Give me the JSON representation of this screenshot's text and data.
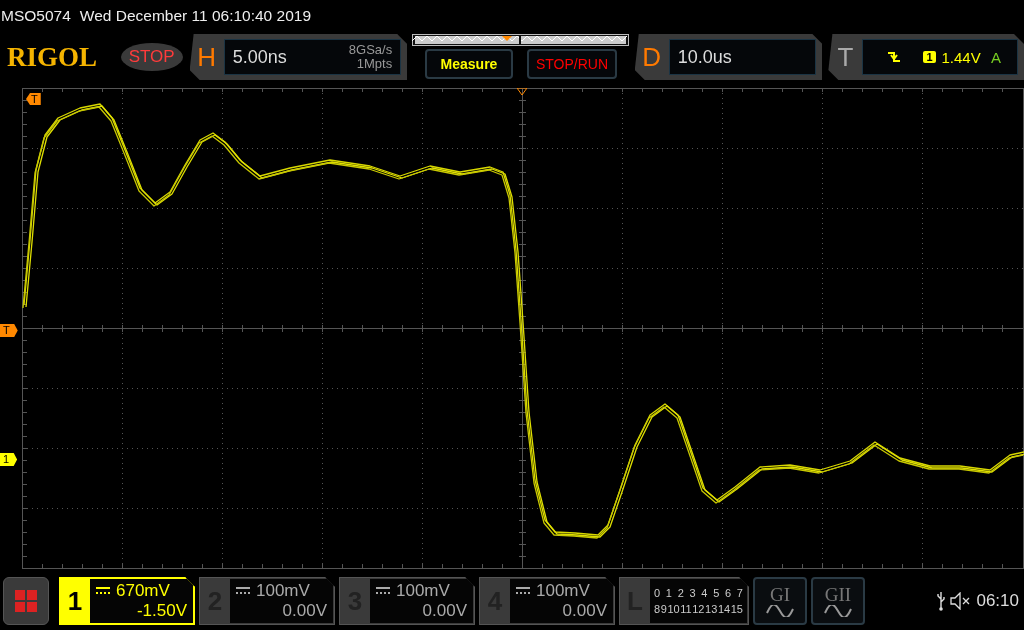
{
  "status_line": {
    "model": "MSO5074",
    "datetime": "Wed December 11 06:10:40 2019"
  },
  "header": {
    "logo": "RIGOL",
    "run_state": "STOP",
    "horizontal": {
      "letter": "H",
      "timebase": "5.00ns",
      "sample_rate": "8GSa/s",
      "memory_depth": "1Mpts"
    },
    "buttons": [
      {
        "label": "Measure",
        "kind": "measure"
      },
      {
        "label": "STOP/RUN",
        "kind": "run"
      }
    ],
    "delay": {
      "letter": "D",
      "value": "10.0us"
    },
    "trigger": {
      "letter": "T",
      "source": "1",
      "level": "1.44V",
      "mode": "A"
    }
  },
  "markers": {
    "trigger_position": "T",
    "trigger_level": "T",
    "channel": "1"
  },
  "channels": [
    {
      "number": "1",
      "scale": "670mV",
      "offset": "-1.50V",
      "selected": true
    },
    {
      "number": "2",
      "scale": "100mV",
      "offset": "0.00V",
      "selected": false
    },
    {
      "number": "3",
      "scale": "100mV",
      "offset": "0.00V",
      "selected": false
    },
    {
      "number": "4",
      "scale": "100mV",
      "offset": "0.00V",
      "selected": false
    }
  ],
  "logic": {
    "letter": "L",
    "row_1": [
      "0",
      "1",
      "2",
      "3",
      "4",
      "5",
      "6",
      "7"
    ],
    "row_2": [
      "8",
      "9",
      "10",
      "11",
      "12",
      "13",
      "14",
      "15"
    ]
  },
  "generators": [
    {
      "label": "GI"
    },
    {
      "label": "GII"
    }
  ],
  "clock": "06:10"
}
